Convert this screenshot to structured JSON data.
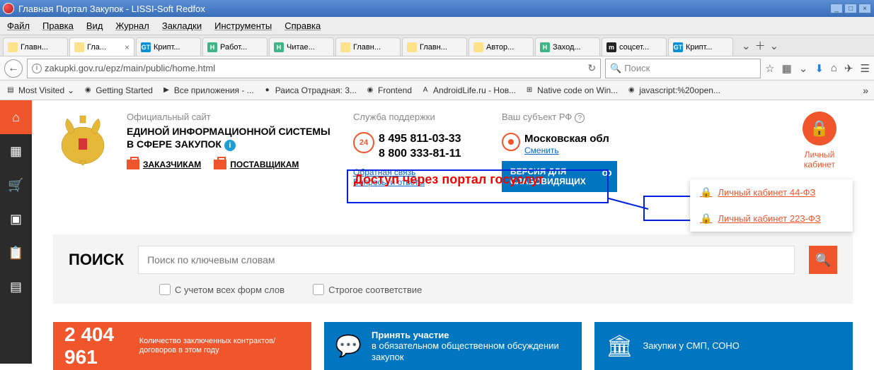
{
  "window": {
    "title": "Главная Портал Закупок - LISSI-Soft Redfox"
  },
  "menu": [
    "Файл",
    "Правка",
    "Вид",
    "Журнал",
    "Закладки",
    "Инструменты",
    "Справка"
  ],
  "tabs": [
    {
      "label": "Главн...",
      "fav": "eagle"
    },
    {
      "label": "Гла...",
      "fav": "eagle",
      "active": true,
      "closable": true
    },
    {
      "label": "Крипт...",
      "fav": "gt"
    },
    {
      "label": "Работ...",
      "fav": "h"
    },
    {
      "label": "Читае...",
      "fav": "h"
    },
    {
      "label": "Главн...",
      "fav": "eagle"
    },
    {
      "label": "Главн...",
      "fav": "eagle"
    },
    {
      "label": "Автор...",
      "fav": "eagle"
    },
    {
      "label": "Заход...",
      "fav": "h"
    },
    {
      "label": "соцсет...",
      "fav": "m"
    },
    {
      "label": "Крипт...",
      "fav": "gt"
    }
  ],
  "nav": {
    "url": "zakupki.gov.ru/epz/main/public/home.html",
    "search_placeholder": "Поиск"
  },
  "bookmarks": [
    {
      "label": "Most Visited",
      "ic": "▤",
      "drop": true
    },
    {
      "label": "Getting Started",
      "ic": "◉"
    },
    {
      "label": "Все приложения - ...",
      "ic": "▶"
    },
    {
      "label": "Раиса Отрадная: 3...",
      "ic": "●"
    },
    {
      "label": "Frontend",
      "ic": "◉"
    },
    {
      "label": "AndroidLife.ru - Нов...",
      "ic": "A"
    },
    {
      "label": "Native code on Win...",
      "ic": "⊞"
    },
    {
      "label": "javascript:%20open...",
      "ic": "◉"
    }
  ],
  "sidebar_icons": [
    "home",
    "calendar",
    "cart",
    "book",
    "clipboard",
    "doc"
  ],
  "head": {
    "small": "Официальный сайт",
    "title": "ЕДИНОЙ ИНФОРМАЦИОННОЙ СИСТЕМЫ В СФЕРЕ ЗАКУПОК",
    "zakazchikam": "ЗАКАЗЧИКАМ",
    "postavshikam": "ПОСТАВЩИКАМ"
  },
  "support": {
    "label": "Служба поддержки",
    "ring": "24",
    "phone1": "8 495 811-03-33",
    "phone2": "8 800 333-81-11",
    "feedback": "Обратная связь",
    "faq": "Вопросы и ответы"
  },
  "region": {
    "label": "Ваш субъект РФ",
    "name": "Московская обл",
    "change": "Сменить"
  },
  "accessibility": {
    "line1": "ВЕРСИЯ ДЛЯ",
    "line2": "СЛАБОВИДЯЩИХ"
  },
  "lk": {
    "btn_line1": "Личный",
    "btn_line2": "кабинет",
    "item44": "Личный кабинет 44-ФЗ",
    "item223": "Личный кабинет 223-ФЗ"
  },
  "annotation": "Доступ через портал госуслуг",
  "search": {
    "title": "ПОИСК",
    "placeholder": "Поиск по ключевым словам",
    "check1": "С учетом всех форм слов",
    "check2": "Строгое соответствие"
  },
  "promos": {
    "count": "2 404 961",
    "count_desc": "Количество заключенных контрактов/ договоров в этом году",
    "discuss_bold": "Принять участие",
    "discuss_rest": "в обязательном общественном обсуждении закупок",
    "smp": "Закупки у СМП, СОНО"
  }
}
